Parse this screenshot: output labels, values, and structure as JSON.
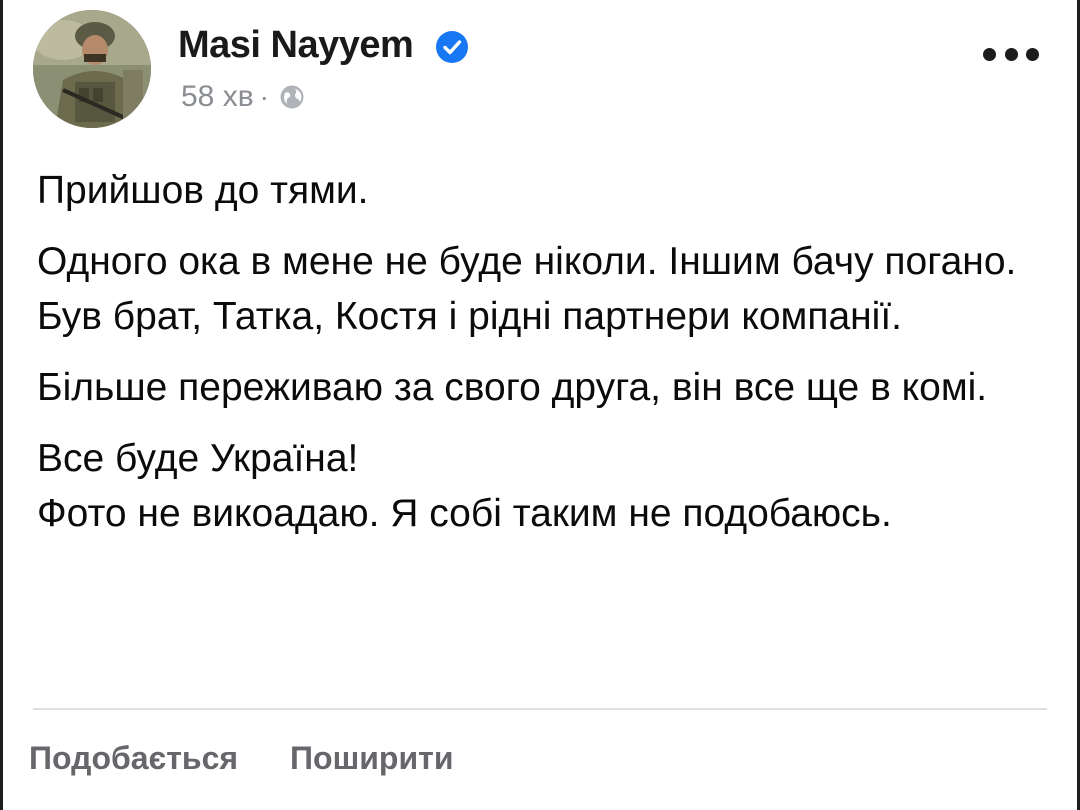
{
  "post": {
    "author": "Masi Nayyem",
    "time": "58 хв",
    "separator": "·",
    "verified": true,
    "paragraphs": [
      "Прийшов до тями.",
      "Одного ока в мене не буде ніколи. Іншим бачу погано. Був брат, Татка, Костя і рідні партнери компанії.",
      "Більше переживаю за свого друга, він все ще в комі.",
      "Все буде Україна!",
      "Фото не викоадаю. Я собі таким не подобаюсь."
    ]
  },
  "actions": {
    "like_label": "Подобається",
    "share_label": "Поширити"
  },
  "colors": {
    "verified_blue": "#1877f2",
    "meta_gray": "#8a8d91",
    "action_gray": "#65676b"
  },
  "icons": {
    "verified": "verified-badge-icon",
    "privacy": "globe-icon",
    "more": "more-options-icon"
  }
}
